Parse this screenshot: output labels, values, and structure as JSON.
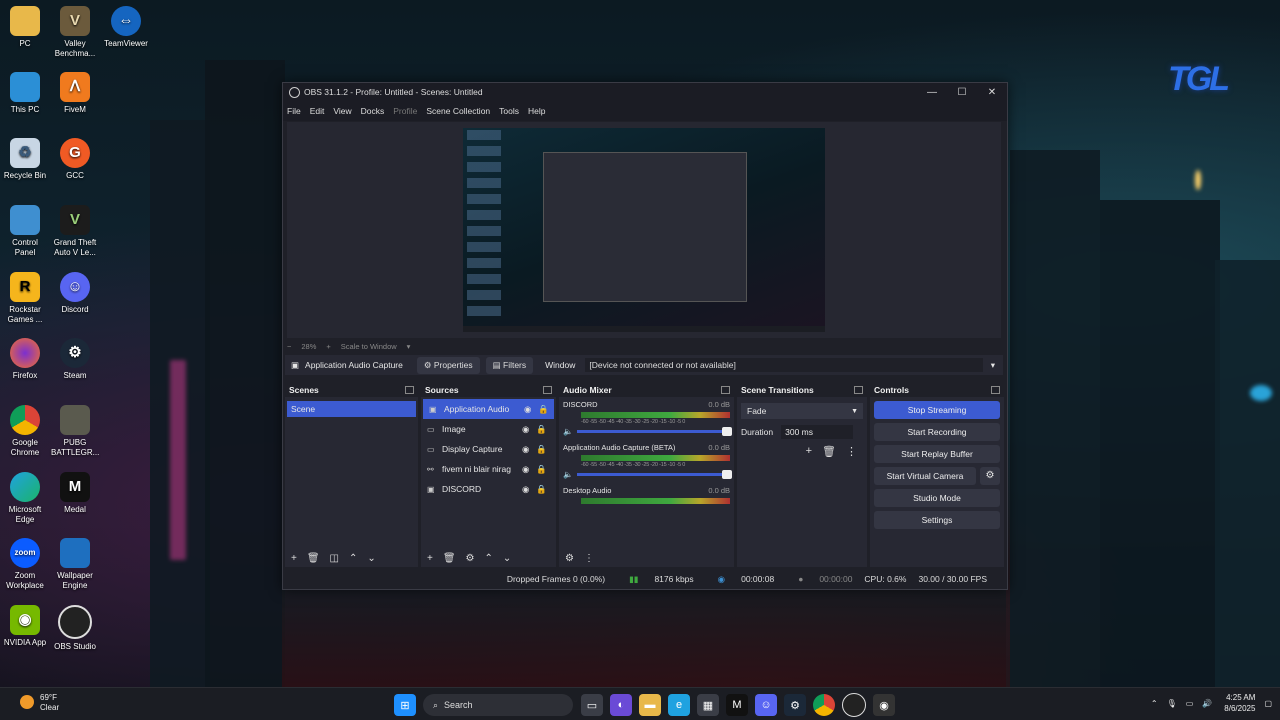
{
  "desktop": {
    "icons": [
      {
        "label": "PC"
      },
      {
        "label": "Valley Benchma..."
      },
      {
        "label": "TeamViewer"
      },
      {
        "label": "This PC"
      },
      {
        "label": "FiveM"
      },
      {
        "label": "Recycle Bin"
      },
      {
        "label": "GCC"
      },
      {
        "label": "Control Panel"
      },
      {
        "label": "Grand Theft Auto V Le..."
      },
      {
        "label": "Rockstar Games ..."
      },
      {
        "label": "Discord"
      },
      {
        "label": "Firefox"
      },
      {
        "label": "Steam"
      },
      {
        "label": "Google Chrome"
      },
      {
        "label": "PUBG BATTLEGR..."
      },
      {
        "label": "Microsoft Edge"
      },
      {
        "label": "Medal"
      },
      {
        "label": "Zoom Workplace"
      },
      {
        "label": "Wallpaper Engine"
      },
      {
        "label": "NVIDIA App"
      },
      {
        "label": "OBS Studio"
      }
    ],
    "brand_logo": "TGL"
  },
  "obs": {
    "title": "OBS 31.1.2 - Profile: Untitled - Scenes: Untitled",
    "menu": [
      "File",
      "Edit",
      "View",
      "Docks",
      "Profile",
      "Scene Collection",
      "Tools",
      "Help"
    ],
    "zoom": {
      "minus": "−",
      "percent": "28%",
      "plus": "+",
      "scale_label": "Scale to Window"
    },
    "source_bar": {
      "selected_source": "Application Audio Capture",
      "properties": "Properties",
      "filters": "Filters",
      "window_label": "Window",
      "window_value": "[Device not connected or not available]"
    },
    "scenes": {
      "title": "Scenes",
      "items": [
        "Scene"
      ]
    },
    "sources": {
      "title": "Sources",
      "items": [
        {
          "name": "Application Audio",
          "icon": "audio-capture-icon"
        },
        {
          "name": "Image",
          "icon": "image-icon"
        },
        {
          "name": "Display Capture",
          "icon": "monitor-icon"
        },
        {
          "name": "fivem ni blair nirag",
          "icon": "link-icon"
        },
        {
          "name": "DISCORD",
          "icon": "window-icon"
        }
      ]
    },
    "audio_mixer": {
      "title": "Audio Mixer",
      "ticks": "-60 -55 -50 -45 -40 -35 -30 -25 -20 -15 -10 -5 0",
      "channels": [
        {
          "name": "DISCORD",
          "db": "0.0 dB"
        },
        {
          "name": "Application Audio Capture (BETA)",
          "db": "0.0 dB"
        },
        {
          "name": "Desktop Audio",
          "db": "0.0 dB"
        }
      ]
    },
    "transitions": {
      "title": "Scene Transitions",
      "selected": "Fade",
      "duration_label": "Duration",
      "duration_value": "300 ms"
    },
    "controls": {
      "title": "Controls",
      "stop_streaming": "Stop Streaming",
      "start_recording": "Start Recording",
      "start_replay": "Start Replay Buffer",
      "start_vcam": "Start Virtual Camera",
      "studio_mode": "Studio Mode",
      "settings": "Settings"
    },
    "status": {
      "dropped": "Dropped Frames 0 (0.0%)",
      "bitrate": "8176 kbps",
      "stream_time": "00:00:08",
      "rec_time": "00:00:00",
      "cpu": "CPU: 0.6%",
      "fps": "30.00 / 30.00 FPS"
    }
  },
  "taskbar": {
    "weather_temp": "69°F",
    "weather_cond": "Clear",
    "search_placeholder": "Search",
    "time": "4:25 AM",
    "date": "8/6/2025"
  },
  "colors": {
    "accent": "#3c5bd1",
    "panel": "#272833",
    "window": "#1f2028"
  }
}
